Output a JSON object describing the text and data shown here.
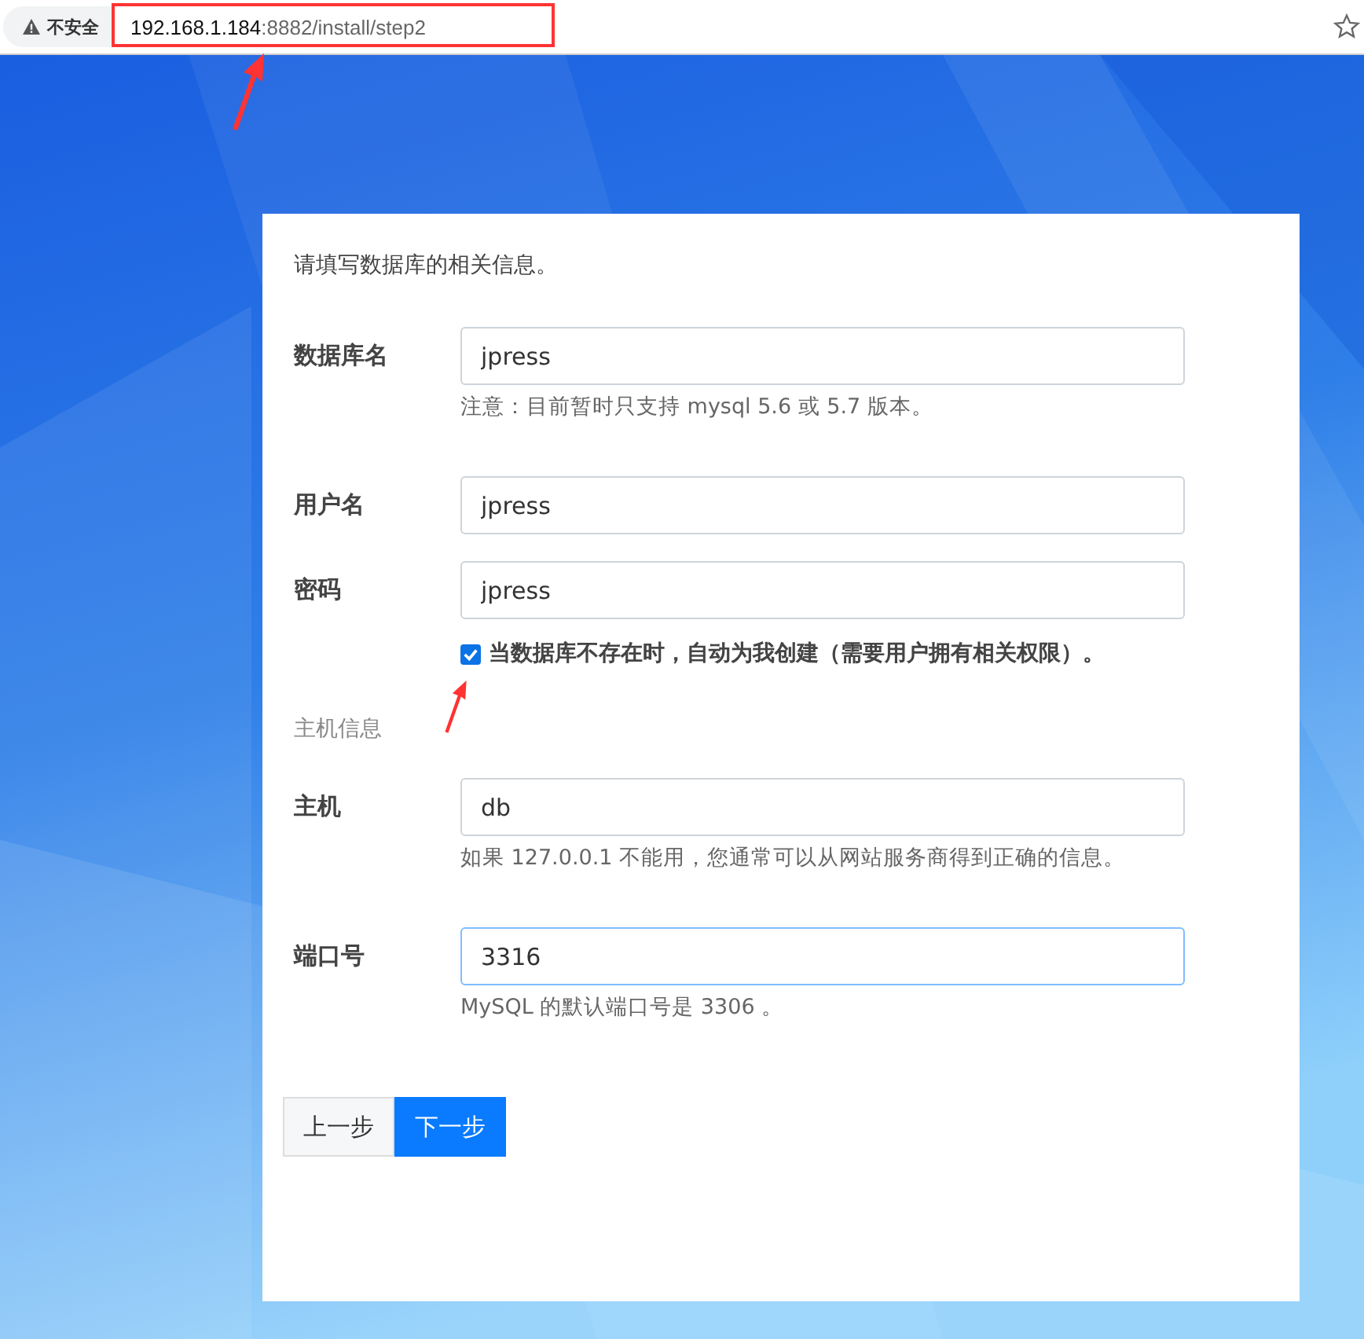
{
  "browser": {
    "security_label": "不安全",
    "url_host": "192.168.1.184",
    "url_rest": ":8882/install/step2"
  },
  "intro": "请填写数据库的相关信息。",
  "sections": [
    {
      "kind": "fields",
      "fields": [
        {
          "label": "数据库名",
          "value": "jpress",
          "focused": false,
          "help": [
            "注意：目前暂时只支持 mysql 5.6 或 5.7 版本。"
          ]
        },
        {
          "label": "用户名",
          "value": "jpress",
          "focused": false
        },
        {
          "label": "密码",
          "value": "jpress",
          "focused": false
        }
      ],
      "checkbox": {
        "label": "当数据库不存在时，自动为我创建（需要用户拥有相关权限）。",
        "checked": true
      }
    },
    {
      "kind": "fields",
      "title": "主机信息",
      "fields": [
        {
          "label": "主机",
          "value": "db",
          "focused": false,
          "help": [
            "如果 127.0.0.1 不能用，您通常可以从网站服务商得到正确的信息。"
          ]
        },
        {
          "label": "端口号",
          "value": "3316",
          "focused": true,
          "help": [
            "MySQL 的默认端口号是 3306 。"
          ]
        }
      ]
    }
  ],
  "buttons": [
    {
      "label": "上一步",
      "kind": "secondary"
    },
    {
      "label": "下一步",
      "kind": "primary"
    }
  ]
}
